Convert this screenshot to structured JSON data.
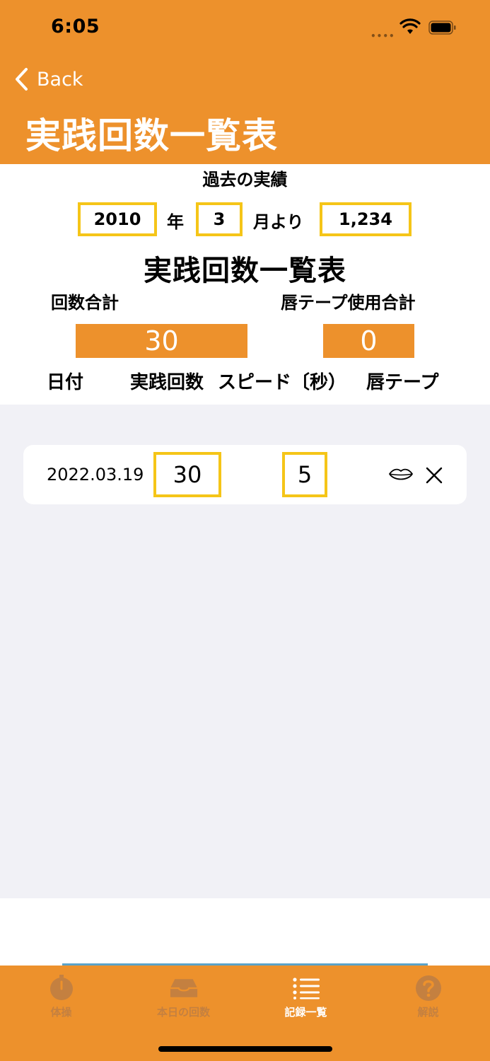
{
  "status_bar": {
    "time": "6:05",
    "signal": "••••"
  },
  "nav": {
    "back_label": "Back",
    "title": "実践回数一覧表"
  },
  "summary": {
    "past_label": "過去の実績",
    "year_value": "2010",
    "year_suffix": "年",
    "month_value": "3",
    "month_suffix": "月より",
    "past_total": "1,234",
    "title": "実践回数一覧表",
    "count_total_label": "回数合計",
    "tape_total_label": "唇テープ使用合計",
    "count_total": "30",
    "tape_total": "0"
  },
  "columns": [
    "日付",
    "実践回数",
    "スピード〔秒）",
    "唇テープ"
  ],
  "records": [
    {
      "date": "2022.03.19",
      "count": "30",
      "speed": "5",
      "lips_icon": "lips-icon",
      "delete_icon": "close-icon"
    }
  ],
  "tabs": [
    {
      "label": "体操",
      "icon": "stopwatch-icon",
      "active": false
    },
    {
      "label": "本日の回数",
      "icon": "tray-icon",
      "active": false
    },
    {
      "label": "記録一覧",
      "icon": "list-icon",
      "active": true
    },
    {
      "label": "解説",
      "icon": "question-icon",
      "active": false
    }
  ],
  "colors": {
    "accent": "#ED912C",
    "highlight_border": "#F5C518",
    "list_bg": "#F1F1F6",
    "tab_inactive": "#C48040"
  }
}
